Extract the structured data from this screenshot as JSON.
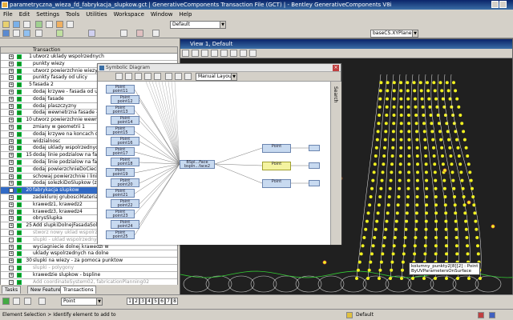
{
  "window": {
    "title": "parametryczna_wieza_fd_fabrykacja_slupkow.gct | GenerativeComponents Transaction File (GCT) | - Bentley GenerativeComponents V8i"
  },
  "menu": [
    "File",
    "Edit",
    "Settings",
    "Tools",
    "Utilities",
    "Workspace",
    "Window",
    "Help"
  ],
  "toolbar": {
    "level_combo": "Default",
    "plane_combo": "baseCS.XYPlane"
  },
  "transactions": {
    "header": "Transaction",
    "rows": [
      {
        "num": "1",
        "text": "utworz uklady wspolrzednych"
      },
      {
        "num": "",
        "text": "punkty wiezy"
      },
      {
        "num": "",
        "text": "utworz powierzchnie wiezy"
      },
      {
        "num": "",
        "text": "punkty fasady od ulicy"
      },
      {
        "num": "5",
        "text": "fasada 2"
      },
      {
        "num": "",
        "text": "dodaj krzywe - fasada od ulicy"
      },
      {
        "num": "",
        "text": "dodaj fasade"
      },
      {
        "num": "",
        "text": "dodaj plaszczyzny"
      },
      {
        "num": "",
        "text": "dodaj wewnetrzna fasade - krzywe"
      },
      {
        "num": "10",
        "text": "utworz powierzchnie wewnetrzna"
      },
      {
        "num": "",
        "text": "zmiany w geometrii 1"
      },
      {
        "num": "",
        "text": "dodaj krzywe na koncach dolnej"
      },
      {
        "num": "",
        "text": "widzialnosc"
      },
      {
        "num": "",
        "text": "dodaj uklady wspolrzednych do"
      },
      {
        "num": "15",
        "text": "dodaj linie podzialow na fasadzie"
      },
      {
        "num": "",
        "text": "dodaj linie podzialow na fasadzie"
      },
      {
        "num": "",
        "text": "dodaj powierzchnieDoCieciaSlupkow"
      },
      {
        "num": "",
        "text": "schowaj powierzchnie i linie"
      },
      {
        "num": "",
        "text": "dodaj solezkiDoSlupkow (z prze"
      },
      {
        "num": "20",
        "text": "fabrykacja slupkow"
      },
      {
        "num": "",
        "text": "zadekluroj grubosciMaterialu"
      },
      {
        "num": "",
        "text": "krawedz1, krawedz2"
      },
      {
        "num": "",
        "text": "krawedz3, krawedz4"
      },
      {
        "num": "",
        "text": "obrysSlupka"
      },
      {
        "num": "25",
        "text": "Add slupkiDolnejFasadaSolid"
      },
      {
        "num": "",
        "text": "stworz nowy uklad wspolrzedny"
      },
      {
        "num": "",
        "text": "slupki - uklad wspolrzednych"
      },
      {
        "num": "",
        "text": "wyciagniecie dolnej krawedzi w"
      },
      {
        "num": "",
        "text": "uklady wspolrzednych na dolne"
      },
      {
        "num": "30",
        "text": "slupki na wiezy - za pomoca punktow"
      },
      {
        "num": "",
        "text": "slupki - polygony"
      },
      {
        "num": "",
        "text": "krawedzie slupkow - bspline"
      },
      {
        "num": "",
        "text": "Add coordinateSystem02, fabricationPlanning02"
      },
      {
        "num": "",
        "text": "Change fabricationPlanning02"
      }
    ]
  },
  "tabs": [
    "Tasks",
    "New Feature",
    "Transactions"
  ],
  "bottombar": {
    "element_combo": "Point",
    "pages": [
      "1",
      "2",
      "3",
      "4",
      "5",
      "6",
      "7",
      "8"
    ]
  },
  "view": {
    "title": "View 1, Default"
  },
  "symbolic": {
    "title": "Symbolic Diagram",
    "layout_combo": "Manual Layout",
    "search_label": "Search",
    "nodes": [
      {
        "type": "Point",
        "name": "point11"
      },
      {
        "type": "Point",
        "name": "point12"
      },
      {
        "type": "Point",
        "name": "point13"
      },
      {
        "type": "Point",
        "name": "point14"
      },
      {
        "type": "Point",
        "name": "point15"
      },
      {
        "type": "Point",
        "name": "point16"
      },
      {
        "type": "Point",
        "name": "point17"
      },
      {
        "type": "Point",
        "name": "point18"
      },
      {
        "type": "Point",
        "name": "point19"
      },
      {
        "type": "Point",
        "name": "point20"
      },
      {
        "type": "Point",
        "name": "point21"
      },
      {
        "type": "Point",
        "name": "point22"
      },
      {
        "type": "Point",
        "name": "point23"
      },
      {
        "type": "Point",
        "name": "point24"
      },
      {
        "type": "Point",
        "name": "point25"
      }
    ],
    "bspline_node": {
      "type": "BSpl...Face",
      "name": "bspln...face2"
    },
    "right_nodes": [
      {
        "type": "Point",
        "name": ""
      },
      {
        "type": "Point",
        "name": ""
      },
      {
        "type": "Point",
        "name": ""
      }
    ]
  },
  "callout": {
    "line1": "kolumny_punkty2[8][2] : Point",
    "line2": "ByUVParametersOnSurface"
  },
  "statusbar": {
    "message": "Element Selection > Identify element to add to",
    "level": "Default"
  }
}
